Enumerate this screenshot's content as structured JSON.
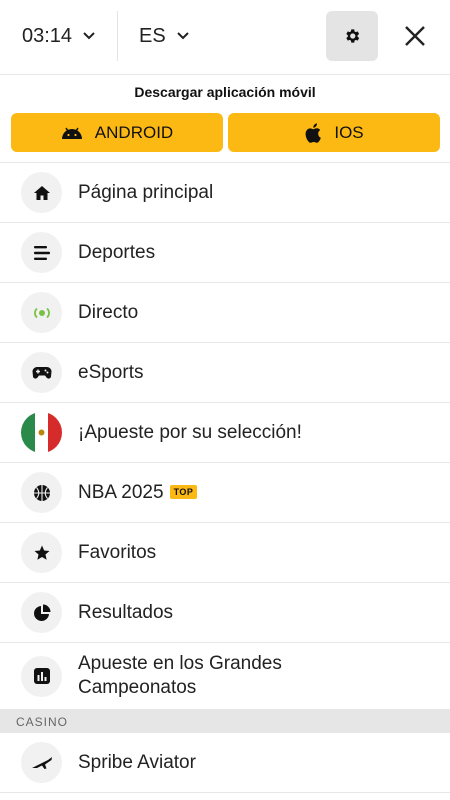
{
  "header": {
    "time": "03:14",
    "language": "ES"
  },
  "download": {
    "title": "Descargar aplicación móvil",
    "android_label": "ANDROID",
    "ios_label": "IOS"
  },
  "menu": {
    "items": [
      {
        "label": "Página principal",
        "icon": "home-icon"
      },
      {
        "label": "Deportes",
        "icon": "sports-list-icon"
      },
      {
        "label": "Directo",
        "icon": "live-icon"
      },
      {
        "label": "eSports",
        "icon": "gamepad-icon"
      },
      {
        "label": "¡Apueste por su selección!",
        "icon": "mexico-flag-icon"
      },
      {
        "label": "NBA 2025",
        "badge": "TOP",
        "icon": "basketball-icon"
      },
      {
        "label": "Favoritos",
        "icon": "star-icon"
      },
      {
        "label": "Resultados",
        "icon": "pie-chart-icon"
      },
      {
        "label": "Apueste en los Grandes Campeonatos",
        "icon": "bar-chart-icon"
      }
    ]
  },
  "casino": {
    "section_title": "CASINO",
    "items": [
      {
        "label": "Spribe Aviator",
        "icon": "airplane-icon"
      }
    ]
  },
  "colors": {
    "accent": "#fdb913",
    "live_green": "#7ac143",
    "icon_bg": "#f1f1f1",
    "section_bg": "#e6e6e6"
  }
}
